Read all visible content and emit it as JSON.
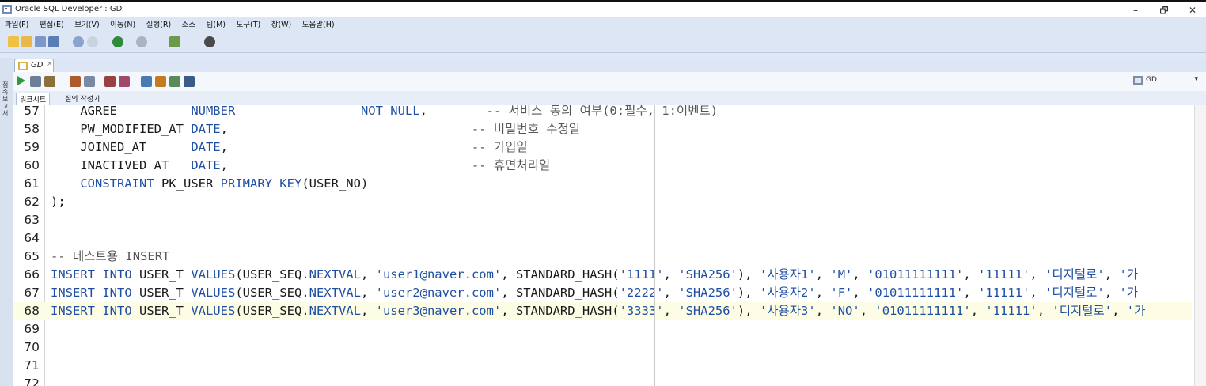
{
  "window": {
    "title": "Oracle SQL Developer : GD",
    "controls": [
      "–",
      "🗗",
      "✕"
    ]
  },
  "menu": [
    "파일(F)",
    "편집(E)",
    "보기(V)",
    "이동(N)",
    "실행(R)",
    "소스",
    "팀(M)",
    "도구(T)",
    "창(W)",
    "도움말(H)"
  ],
  "editor_tab": {
    "label": "GD",
    "close": "×"
  },
  "left_panel_label": "접속\n보고서",
  "connection": {
    "name": "GD"
  },
  "subtabs": [
    "워크시트",
    "질의 작성기"
  ],
  "lines": [
    {
      "num": "57",
      "parts": [
        [
          "",
          "    AGREE          "
        ],
        [
          "kw",
          "NUMBER"
        ],
        [
          "",
          "                 "
        ],
        [
          "kw",
          "NOT NULL"
        ],
        [
          "",
          ",        "
        ],
        [
          "cmt",
          "-- 서비스 동의 여부(0:필수, 1:이벤트)"
        ]
      ]
    },
    {
      "num": "58",
      "parts": [
        [
          "",
          "    PW_MODIFIED_AT "
        ],
        [
          "kw",
          "DATE"
        ],
        [
          "",
          ",                                 "
        ],
        [
          "cmt",
          "-- 비밀번호 수정일"
        ]
      ]
    },
    {
      "num": "59",
      "parts": [
        [
          "",
          "    JOINED_AT      "
        ],
        [
          "kw",
          "DATE"
        ],
        [
          "",
          ",                                 "
        ],
        [
          "cmt",
          "-- 가입일"
        ]
      ]
    },
    {
      "num": "60",
      "parts": [
        [
          "",
          "    INACTIVED_AT   "
        ],
        [
          "kw",
          "DATE"
        ],
        [
          "",
          ",                                 "
        ],
        [
          "cmt",
          "-- 휴면처리일"
        ]
      ]
    },
    {
      "num": "61",
      "parts": [
        [
          "",
          "    "
        ],
        [
          "kw",
          "CONSTRAINT"
        ],
        [
          "",
          " PK_USER "
        ],
        [
          "kw",
          "PRIMARY KEY"
        ],
        [
          "",
          "(USER_NO)"
        ]
      ]
    },
    {
      "num": "62",
      "parts": [
        [
          "",
          ");"
        ]
      ]
    },
    {
      "num": "63",
      "parts": []
    },
    {
      "num": "64",
      "parts": []
    },
    {
      "num": "65",
      "parts": [
        [
          "cmt",
          "-- 테스트용 INSERT"
        ]
      ]
    },
    {
      "num": "66",
      "parts": [
        [
          "kw",
          "INSERT INTO"
        ],
        [
          "",
          " USER_T "
        ],
        [
          "kw",
          "VALUES"
        ],
        [
          "",
          "(USER_SEQ."
        ],
        [
          "kw",
          "NEXTVAL"
        ],
        [
          "",
          ", "
        ],
        [
          "str",
          "'user1@naver.com'"
        ],
        [
          "",
          ", STANDARD_HASH("
        ],
        [
          "str",
          "'1111'"
        ],
        [
          "",
          ", "
        ],
        [
          "str",
          "'SHA256'"
        ],
        [
          "",
          "), "
        ],
        [
          "str",
          "'사용자1'"
        ],
        [
          "",
          ", "
        ],
        [
          "str",
          "'M'"
        ],
        [
          "",
          ", "
        ],
        [
          "str",
          "'01011111111'"
        ],
        [
          "",
          ", "
        ],
        [
          "str",
          "'11111'"
        ],
        [
          "",
          ", "
        ],
        [
          "str",
          "'디지털로'"
        ],
        [
          "",
          ", "
        ],
        [
          "str",
          "'가"
        ]
      ]
    },
    {
      "num": "67",
      "parts": [
        [
          "kw",
          "INSERT INTO"
        ],
        [
          "",
          " USER_T "
        ],
        [
          "kw",
          "VALUES"
        ],
        [
          "",
          "(USER_SEQ."
        ],
        [
          "kw",
          "NEXTVAL"
        ],
        [
          "",
          ", "
        ],
        [
          "str",
          "'user2@naver.com'"
        ],
        [
          "",
          ", STANDARD_HASH("
        ],
        [
          "str",
          "'2222'"
        ],
        [
          "",
          ", "
        ],
        [
          "str",
          "'SHA256'"
        ],
        [
          "",
          "), "
        ],
        [
          "str",
          "'사용자2'"
        ],
        [
          "",
          ", "
        ],
        [
          "str",
          "'F'"
        ],
        [
          "",
          ", "
        ],
        [
          "str",
          "'01011111111'"
        ],
        [
          "",
          ", "
        ],
        [
          "str",
          "'11111'"
        ],
        [
          "",
          ", "
        ],
        [
          "str",
          "'디지털로'"
        ],
        [
          "",
          ", "
        ],
        [
          "str",
          "'가"
        ]
      ]
    },
    {
      "num": "68",
      "active": true,
      "parts": [
        [
          "kw",
          "INSERT INTO"
        ],
        [
          "",
          " USER_T "
        ],
        [
          "kw",
          "VALUES"
        ],
        [
          "",
          "(USER_SEQ."
        ],
        [
          "kw",
          "NEXTVAL"
        ],
        [
          "",
          ", "
        ],
        [
          "str",
          "'user3@naver.com'"
        ],
        [
          "",
          ", STANDARD_HASH("
        ],
        [
          "str",
          "'3333'"
        ],
        [
          "",
          ", "
        ],
        [
          "str",
          "'SHA256'"
        ],
        [
          "",
          "), "
        ],
        [
          "str",
          "'사용자3'"
        ],
        [
          "",
          ", "
        ],
        [
          "str",
          "'NO'"
        ],
        [
          "",
          ", "
        ],
        [
          "str",
          "'01011111111'"
        ],
        [
          "",
          ", "
        ],
        [
          "str",
          "'11111'"
        ],
        [
          "",
          ", "
        ],
        [
          "str",
          "'디지털로'"
        ],
        [
          "",
          ", "
        ],
        [
          "str",
          "'가"
        ]
      ]
    },
    {
      "num": "69",
      "parts": []
    },
    {
      "num": "70",
      "parts": []
    },
    {
      "num": "71",
      "parts": []
    },
    {
      "num": "72",
      "parts": []
    }
  ]
}
